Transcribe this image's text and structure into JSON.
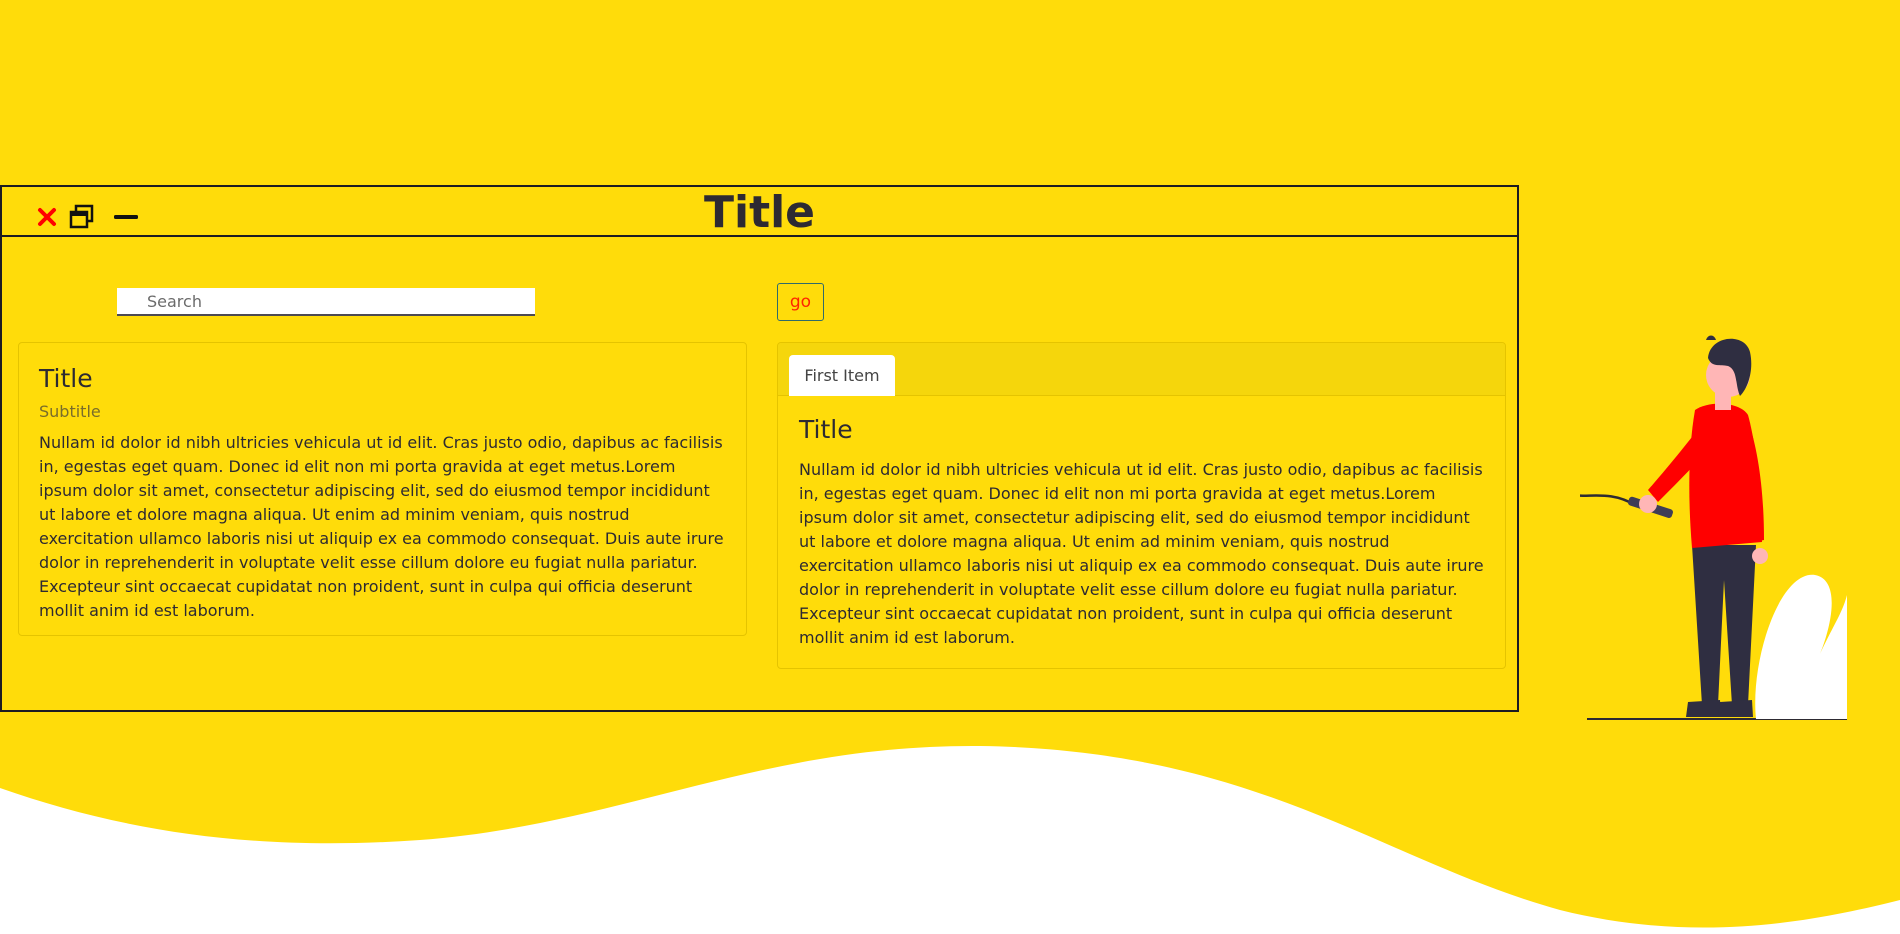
{
  "window": {
    "title": "Title",
    "controls": [
      "close-icon",
      "restore-icon",
      "minimize-icon"
    ],
    "close_color": "#FF0000"
  },
  "search": {
    "placeholder": "Search",
    "value": "",
    "go_label": "go"
  },
  "card": {
    "title": "Title",
    "subtitle": "Subtitle",
    "text": "Nullam id dolor id nibh ultricies vehicula ut id elit. Cras justo odio, dapibus ac facilisis in, egestas eget quam. Donec id elit non mi porta gravida at eget metus.Lorem ipsum dolor sit amet, consectetur adipiscing elit, sed do eiusmod tempor incididunt ut labore et dolore magna aliqua. Ut enim ad minim veniam, quis nostrud exercitation ullamco laboris nisi ut aliquip ex ea commodo consequat. Duis aute irure dolor in reprehenderit in voluptate velit esse cillum dolore eu fugiat nulla pariatur. Excepteur sint occaecat cupidatat non proident, sunt in culpa qui officia deserunt mollit anim id est laborum."
  },
  "tabs": {
    "items": [
      {
        "label": "First Item",
        "active": true
      }
    ],
    "panel": {
      "title": "Title",
      "text": "Nullam id dolor id nibh ultricies vehicula ut id elit. Cras justo odio, dapibus ac facilisis in, egestas eget quam. Donec id elit non mi porta gravida at eget metus.Lorem ipsum dolor sit amet, consectetur adipiscing elit, sed do eiusmod tempor incididunt ut labore et dolore magna aliqua. Ut enim ad minim veniam, quis nostrud exercitation ullamco laboris nisi ut aliquip ex ea commodo consequat. Duis aute irure dolor in reprehenderit in voluptate velit esse cillum dolore eu fugiat nulla pariatur. Excepteur sint occaecat cupidatat non proident, sunt in culpa qui officia deserunt mollit anim id est laborum."
    }
  },
  "colors": {
    "background": "#FFDC0A",
    "accent": "#FF0000",
    "text": "#2D2A32",
    "tab_header": "#F5D60C"
  }
}
